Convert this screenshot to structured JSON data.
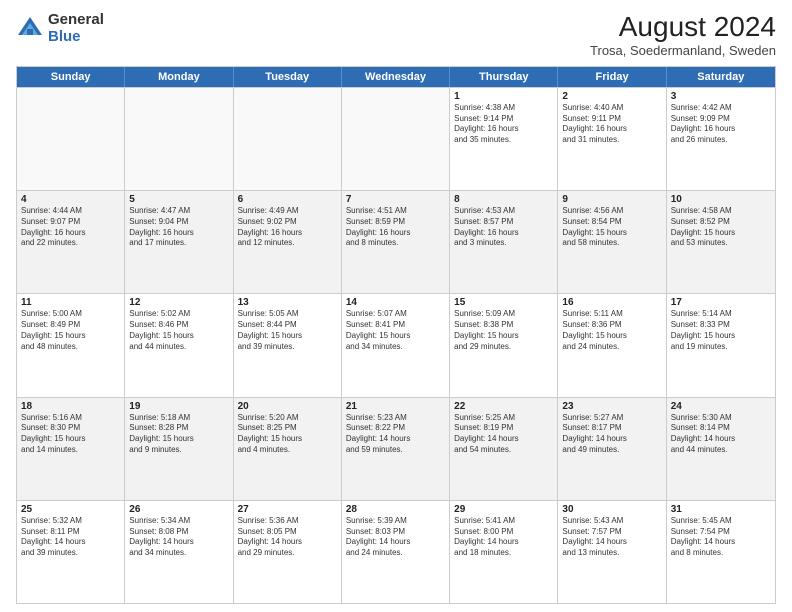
{
  "logo": {
    "general": "General",
    "blue": "Blue"
  },
  "title": "August 2024",
  "subtitle": "Trosa, Soedermanland, Sweden",
  "headers": [
    "Sunday",
    "Monday",
    "Tuesday",
    "Wednesday",
    "Thursday",
    "Friday",
    "Saturday"
  ],
  "rows": [
    [
      {
        "day": "",
        "info": ""
      },
      {
        "day": "",
        "info": ""
      },
      {
        "day": "",
        "info": ""
      },
      {
        "day": "",
        "info": ""
      },
      {
        "day": "1",
        "info": "Sunrise: 4:38 AM\nSunset: 9:14 PM\nDaylight: 16 hours\nand 35 minutes."
      },
      {
        "day": "2",
        "info": "Sunrise: 4:40 AM\nSunset: 9:11 PM\nDaylight: 16 hours\nand 31 minutes."
      },
      {
        "day": "3",
        "info": "Sunrise: 4:42 AM\nSunset: 9:09 PM\nDaylight: 16 hours\nand 26 minutes."
      }
    ],
    [
      {
        "day": "4",
        "info": "Sunrise: 4:44 AM\nSunset: 9:07 PM\nDaylight: 16 hours\nand 22 minutes."
      },
      {
        "day": "5",
        "info": "Sunrise: 4:47 AM\nSunset: 9:04 PM\nDaylight: 16 hours\nand 17 minutes."
      },
      {
        "day": "6",
        "info": "Sunrise: 4:49 AM\nSunset: 9:02 PM\nDaylight: 16 hours\nand 12 minutes."
      },
      {
        "day": "7",
        "info": "Sunrise: 4:51 AM\nSunset: 8:59 PM\nDaylight: 16 hours\nand 8 minutes."
      },
      {
        "day": "8",
        "info": "Sunrise: 4:53 AM\nSunset: 8:57 PM\nDaylight: 16 hours\nand 3 minutes."
      },
      {
        "day": "9",
        "info": "Sunrise: 4:56 AM\nSunset: 8:54 PM\nDaylight: 15 hours\nand 58 minutes."
      },
      {
        "day": "10",
        "info": "Sunrise: 4:58 AM\nSunset: 8:52 PM\nDaylight: 15 hours\nand 53 minutes."
      }
    ],
    [
      {
        "day": "11",
        "info": "Sunrise: 5:00 AM\nSunset: 8:49 PM\nDaylight: 15 hours\nand 48 minutes."
      },
      {
        "day": "12",
        "info": "Sunrise: 5:02 AM\nSunset: 8:46 PM\nDaylight: 15 hours\nand 44 minutes."
      },
      {
        "day": "13",
        "info": "Sunrise: 5:05 AM\nSunset: 8:44 PM\nDaylight: 15 hours\nand 39 minutes."
      },
      {
        "day": "14",
        "info": "Sunrise: 5:07 AM\nSunset: 8:41 PM\nDaylight: 15 hours\nand 34 minutes."
      },
      {
        "day": "15",
        "info": "Sunrise: 5:09 AM\nSunset: 8:38 PM\nDaylight: 15 hours\nand 29 minutes."
      },
      {
        "day": "16",
        "info": "Sunrise: 5:11 AM\nSunset: 8:36 PM\nDaylight: 15 hours\nand 24 minutes."
      },
      {
        "day": "17",
        "info": "Sunrise: 5:14 AM\nSunset: 8:33 PM\nDaylight: 15 hours\nand 19 minutes."
      }
    ],
    [
      {
        "day": "18",
        "info": "Sunrise: 5:16 AM\nSunset: 8:30 PM\nDaylight: 15 hours\nand 14 minutes."
      },
      {
        "day": "19",
        "info": "Sunrise: 5:18 AM\nSunset: 8:28 PM\nDaylight: 15 hours\nand 9 minutes."
      },
      {
        "day": "20",
        "info": "Sunrise: 5:20 AM\nSunset: 8:25 PM\nDaylight: 15 hours\nand 4 minutes."
      },
      {
        "day": "21",
        "info": "Sunrise: 5:23 AM\nSunset: 8:22 PM\nDaylight: 14 hours\nand 59 minutes."
      },
      {
        "day": "22",
        "info": "Sunrise: 5:25 AM\nSunset: 8:19 PM\nDaylight: 14 hours\nand 54 minutes."
      },
      {
        "day": "23",
        "info": "Sunrise: 5:27 AM\nSunset: 8:17 PM\nDaylight: 14 hours\nand 49 minutes."
      },
      {
        "day": "24",
        "info": "Sunrise: 5:30 AM\nSunset: 8:14 PM\nDaylight: 14 hours\nand 44 minutes."
      }
    ],
    [
      {
        "day": "25",
        "info": "Sunrise: 5:32 AM\nSunset: 8:11 PM\nDaylight: 14 hours\nand 39 minutes."
      },
      {
        "day": "26",
        "info": "Sunrise: 5:34 AM\nSunset: 8:08 PM\nDaylight: 14 hours\nand 34 minutes."
      },
      {
        "day": "27",
        "info": "Sunrise: 5:36 AM\nSunset: 8:05 PM\nDaylight: 14 hours\nand 29 minutes."
      },
      {
        "day": "28",
        "info": "Sunrise: 5:39 AM\nSunset: 8:03 PM\nDaylight: 14 hours\nand 24 minutes."
      },
      {
        "day": "29",
        "info": "Sunrise: 5:41 AM\nSunset: 8:00 PM\nDaylight: 14 hours\nand 18 minutes."
      },
      {
        "day": "30",
        "info": "Sunrise: 5:43 AM\nSunset: 7:57 PM\nDaylight: 14 hours\nand 13 minutes."
      },
      {
        "day": "31",
        "info": "Sunrise: 5:45 AM\nSunset: 7:54 PM\nDaylight: 14 hours\nand 8 minutes."
      }
    ]
  ]
}
